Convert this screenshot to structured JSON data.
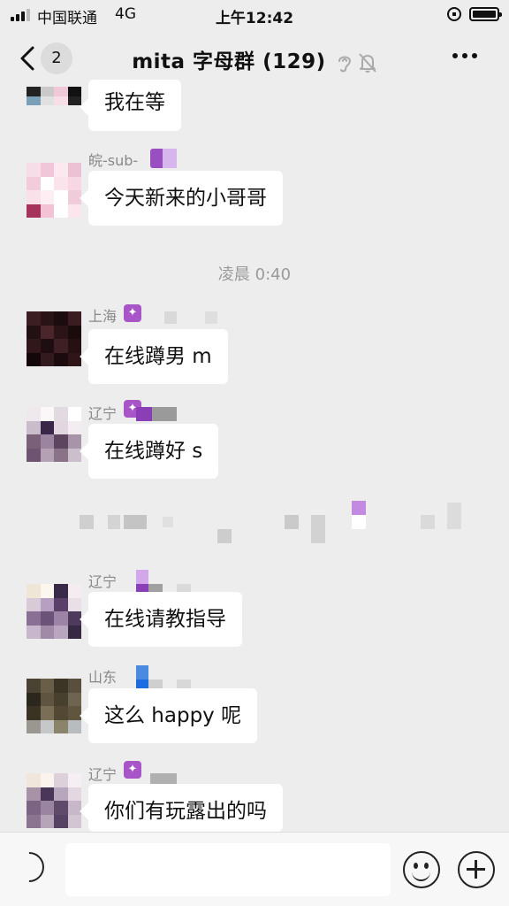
{
  "status_bar": {
    "carrier": "中国联通",
    "network": "4G",
    "time": "上午12:42"
  },
  "header": {
    "back_badge": "2",
    "title": "mita 字母群 (129)",
    "icons": [
      "ear-icon",
      "bell-muted-icon",
      "more-icon"
    ]
  },
  "messages": [
    {
      "sender": "",
      "text": "我在等"
    },
    {
      "sender": "皖-sub-",
      "text": "今天新来的小哥哥"
    },
    {
      "sender": "上海",
      "text": "在线蹲男 m"
    },
    {
      "sender": "辽宁",
      "text": "在线蹲好 s"
    },
    {
      "sender": "辽宁",
      "text": "在线请教指导"
    },
    {
      "sender": "山东",
      "text": "这么 happy 呢"
    },
    {
      "sender": "辽宁",
      "text": "你们有玩露出的吗"
    }
  ],
  "timestamp": "凌晨 0:40",
  "input_bar": {
    "placeholder": "",
    "icons": [
      "voice-icon",
      "emoji-icon",
      "plus-icon"
    ]
  },
  "colors": {
    "background": "#ededed",
    "bubble": "#ffffff",
    "badge": "#a855c8",
    "timestamp": "#9a9a9a"
  }
}
